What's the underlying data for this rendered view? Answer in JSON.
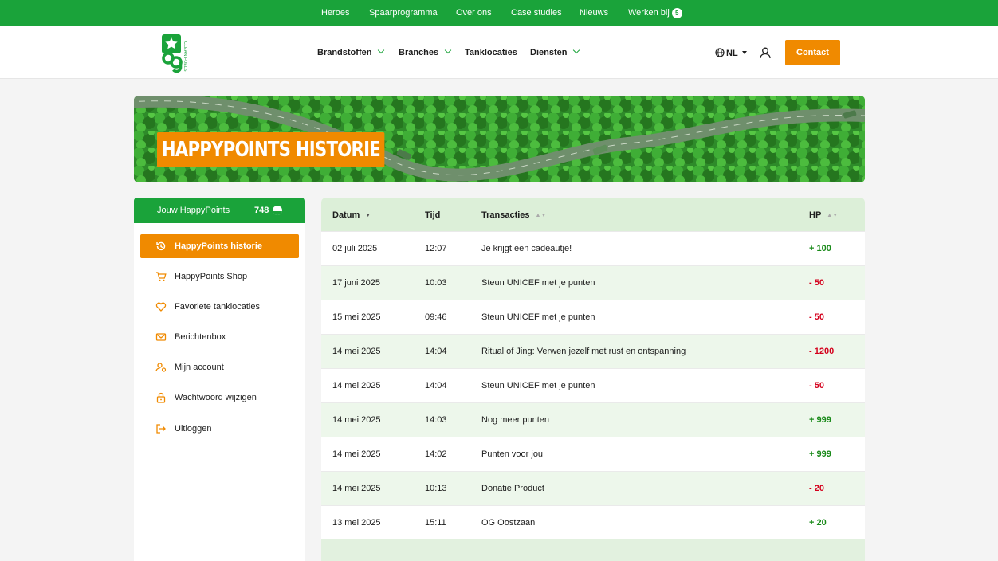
{
  "topnav": {
    "heroes": "Heroes",
    "spaarprogramma": "Spaarprogramma",
    "over_ons": "Over ons",
    "case_studies": "Case studies",
    "nieuws": "Nieuws",
    "werken_bij": "Werken bij",
    "werken_bij_badge": "5"
  },
  "brand": {
    "logo_text": "og",
    "logo_side_text": "CLEAN FUELS"
  },
  "mainnav": {
    "brandstoffen": "Brandstoffen",
    "branches": "Branches",
    "tanklocaties": "Tanklocaties",
    "diensten": "Diensten",
    "language": "NL",
    "contact": "Contact"
  },
  "hero": {
    "title": "HAPPYPOINTS HISTORIE"
  },
  "sidebar": {
    "header_label": "Jouw HappyPoints",
    "points": "748",
    "items": [
      {
        "label": "HappyPoints historie",
        "icon": "history-icon"
      },
      {
        "label": "HappyPoints Shop",
        "icon": "cart-icon"
      },
      {
        "label": "Favoriete tanklocaties",
        "icon": "heart-icon"
      },
      {
        "label": "Berichtenbox",
        "icon": "mail-icon"
      },
      {
        "label": "Mijn account",
        "icon": "user-settings-icon"
      },
      {
        "label": "Wachtwoord wijzigen",
        "icon": "lock-icon"
      },
      {
        "label": "Uitloggen",
        "icon": "logout-icon"
      }
    ]
  },
  "table": {
    "headers": {
      "datum": "Datum",
      "tijd": "Tijd",
      "transacties": "Transacties",
      "hp": "HP"
    },
    "rows": [
      {
        "datum": "02 juli 2025",
        "tijd": "12:07",
        "transactie": "Je krijgt een cadeautje!",
        "hp": "+ 100"
      },
      {
        "datum": "17 juni 2025",
        "tijd": "10:03",
        "transactie": "Steun UNICEF met je punten",
        "hp": "- 50"
      },
      {
        "datum": "15 mei 2025",
        "tijd": "09:46",
        "transactie": "Steun UNICEF met je punten",
        "hp": "- 50"
      },
      {
        "datum": "14 mei 2025",
        "tijd": "14:04",
        "transactie": "Ritual of Jing: Verwen jezelf met rust en ontspanning",
        "hp": "- 1200"
      },
      {
        "datum": "14 mei 2025",
        "tijd": "14:04",
        "transactie": "Steun UNICEF met je punten",
        "hp": "- 50"
      },
      {
        "datum": "14 mei 2025",
        "tijd": "14:03",
        "transactie": "Nog meer punten",
        "hp": "+ 999"
      },
      {
        "datum": "14 mei 2025",
        "tijd": "14:02",
        "transactie": "Punten voor jou",
        "hp": "+ 999"
      },
      {
        "datum": "14 mei 2025",
        "tijd": "10:13",
        "transactie": "Donatie Product",
        "hp": "- 20"
      },
      {
        "datum": "13 mei 2025",
        "tijd": "15:11",
        "transactie": "OG Oostzaan",
        "hp": "+ 20"
      }
    ]
  },
  "colors": {
    "brand_green": "#1aa33a",
    "accent_orange": "#f08a00",
    "positive": "#1a8a1a",
    "negative": "#d4001c"
  }
}
